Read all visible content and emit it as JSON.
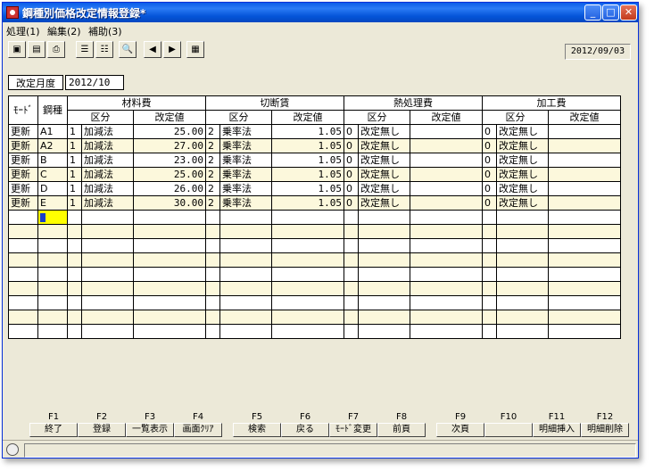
{
  "window": {
    "title": "鋼種別価格改定情報登録*",
    "min_glyph": "_",
    "max_glyph": "□",
    "close_glyph": "✕"
  },
  "menu": [
    "処理(1)",
    "編集(2)",
    "補助(3)"
  ],
  "toolbar": {
    "buttons": [
      "open-folder-icon",
      "save-icon",
      "print-icon",
      "list-icon",
      "list2-icon",
      "search-icon",
      "prev-icon",
      "next-icon",
      "grid-icon"
    ],
    "glyphs": [
      "▣",
      "▤",
      "⎙",
      "☰",
      "☷",
      "🔍",
      "◀",
      "▶",
      "▦"
    ],
    "date": "2012/09/03"
  },
  "form": {
    "month_label": "改定月度",
    "month_value": "2012/10"
  },
  "grid": {
    "headers": {
      "mode": "ﾓｰﾄﾞ",
      "steel": "鋼種",
      "material": "材料費",
      "cutting": "切断賃",
      "heat": "熱処理費",
      "processing": "加工費",
      "kubun": "区分",
      "value": "改定値"
    },
    "rows": [
      {
        "mode": "更新",
        "steel": "A1",
        "m_code": "1",
        "m_name": "加減法",
        "m_val": "25.00",
        "c_code": "2",
        "c_name": "乗率法",
        "c_val": "1.05",
        "h_code": "0",
        "h_name": "改定無し",
        "h_val": "",
        "p_code": "0",
        "p_name": "改定無し",
        "p_val": ""
      },
      {
        "mode": "更新",
        "steel": "A2",
        "m_code": "1",
        "m_name": "加減法",
        "m_val": "27.00",
        "c_code": "2",
        "c_name": "乗率法",
        "c_val": "1.05",
        "h_code": "0",
        "h_name": "改定無し",
        "h_val": "",
        "p_code": "0",
        "p_name": "改定無し",
        "p_val": ""
      },
      {
        "mode": "更新",
        "steel": "B",
        "m_code": "1",
        "m_name": "加減法",
        "m_val": "23.00",
        "c_code": "2",
        "c_name": "乗率法",
        "c_val": "1.05",
        "h_code": "0",
        "h_name": "改定無し",
        "h_val": "",
        "p_code": "0",
        "p_name": "改定無し",
        "p_val": ""
      },
      {
        "mode": "更新",
        "steel": "C",
        "m_code": "1",
        "m_name": "加減法",
        "m_val": "25.00",
        "c_code": "2",
        "c_name": "乗率法",
        "c_val": "1.05",
        "h_code": "0",
        "h_name": "改定無し",
        "h_val": "",
        "p_code": "0",
        "p_name": "改定無し",
        "p_val": ""
      },
      {
        "mode": "更新",
        "steel": "D",
        "m_code": "1",
        "m_name": "加減法",
        "m_val": "26.00",
        "c_code": "2",
        "c_name": "乗率法",
        "c_val": "1.05",
        "h_code": "0",
        "h_name": "改定無し",
        "h_val": "",
        "p_code": "0",
        "p_name": "改定無し",
        "p_val": ""
      },
      {
        "mode": "更新",
        "steel": "E",
        "m_code": "1",
        "m_name": "加減法",
        "m_val": "30.00",
        "c_code": "2",
        "c_name": "乗率法",
        "c_val": "1.05",
        "h_code": "0",
        "h_name": "改定無し",
        "h_val": "",
        "p_code": "0",
        "p_name": "改定無し",
        "p_val": ""
      }
    ],
    "empty_rows": 9
  },
  "fkeys": [
    {
      "key": "F1",
      "label": "終了"
    },
    {
      "key": "F2",
      "label": "登録"
    },
    {
      "key": "F3",
      "label": "一覧表示"
    },
    {
      "key": "F4",
      "label": "画面ｸﾘｱ"
    },
    {
      "key": "F5",
      "label": "検索"
    },
    {
      "key": "F6",
      "label": "戻る"
    },
    {
      "key": "F7",
      "label": "ﾓｰﾄﾞ変更"
    },
    {
      "key": "F8",
      "label": "前頁"
    },
    {
      "key": "F9",
      "label": "次頁"
    },
    {
      "key": "F10",
      "label": ""
    },
    {
      "key": "F11",
      "label": "明細挿入"
    },
    {
      "key": "F12",
      "label": "明細削除"
    }
  ],
  "colors": {
    "title_blue": "#0a5ce8",
    "row_alt": "#fcf8dc",
    "selected": "#ffff00"
  }
}
